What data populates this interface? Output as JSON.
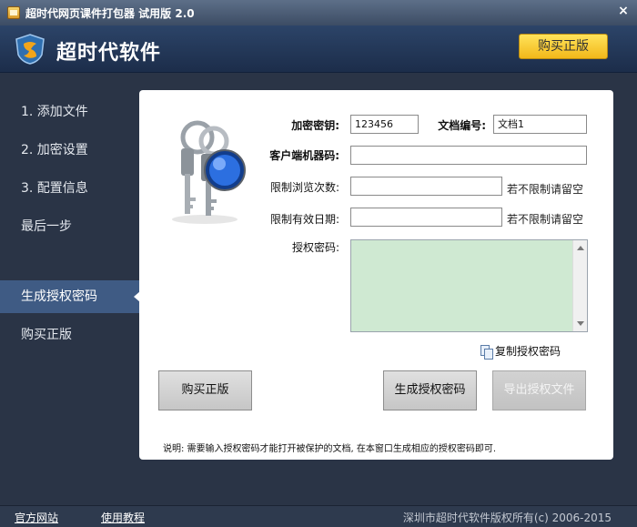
{
  "window": {
    "title": "超时代网页课件打包器 试用版 2.0",
    "close_glyph": "×"
  },
  "header": {
    "brand": "超时代软件",
    "buy_label": "购买正版"
  },
  "sidebar": {
    "items": [
      {
        "label": "1. 添加文件"
      },
      {
        "label": "2. 加密设置"
      },
      {
        "label": "3. 配置信息"
      },
      {
        "label": "最后一步"
      },
      {
        "label": "生成授权密码",
        "active": true
      },
      {
        "label": "购买正版"
      }
    ]
  },
  "form": {
    "encrypt_key_label": "加密密钥:",
    "encrypt_key_value": "123456",
    "doc_no_label": "文档编号:",
    "doc_no_value": "文档1",
    "machine_code_label": "客户端机器码:",
    "machine_code_value": "",
    "browse_limit_label": "限制浏览次数:",
    "browse_limit_value": "",
    "browse_limit_hint": "若不限制请留空",
    "date_limit_label": "限制有效日期:",
    "date_limit_value": "",
    "date_limit_hint": "若不限制请留空",
    "auth_code_label": "授权密码:",
    "auth_code_value": "",
    "copy_label": "复制授权密码"
  },
  "buttons": {
    "buy": "购买正版",
    "generate": "生成授权密码",
    "export": "导出授权文件"
  },
  "note": "说明: 需要输入授权密码才能打开被保护的文档, 在本窗口生成相应的授权密码即可.",
  "footer": {
    "official_site": "官方网站",
    "tutorial": "使用教程",
    "copyright": "深圳市超时代软件版权所有(c) 2006-2015"
  },
  "colors": {
    "accent": "#3f5b84",
    "buy_button": "#f7c62d",
    "auth_area": "#cfe9d2"
  }
}
